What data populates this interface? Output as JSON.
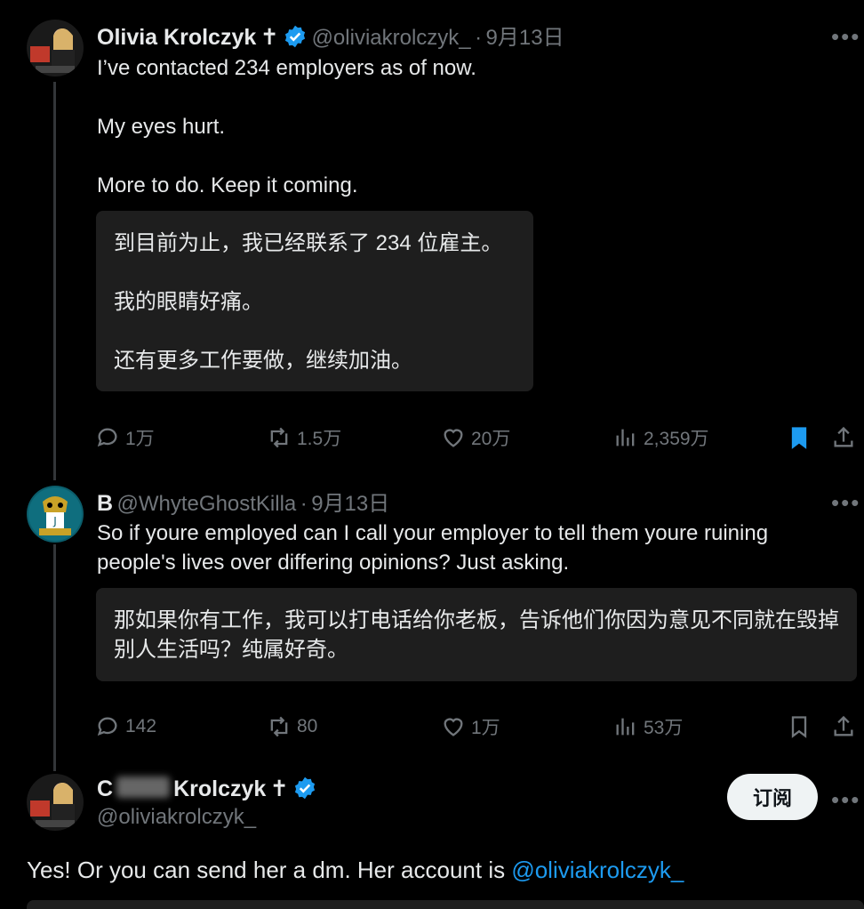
{
  "tweet1": {
    "name": "Olivia Krolczyk",
    "cross": "✝",
    "handle": "@oliviakrolczyk_",
    "dot": "·",
    "date": "9月13日",
    "text": "I’ve contacted 234 employers as of now.\n\nMy eyes hurt.\n\nMore to do. Keep it coming.",
    "translation": "到目前为止，我已经联系了 234 位雇主。\n\n我的眼睛好痛。\n\n还有更多工作要做，继续加油。",
    "replies": "1万",
    "retweets": "1.5万",
    "likes": "20万",
    "views": "2,359万",
    "bookmarked": true
  },
  "tweet2": {
    "name": "B",
    "handle": "@WhyteGhostKilla",
    "dot": "·",
    "date": "9月13日",
    "text": "So if youre employed can I call your employer to tell them youre ruining people's lives over differing opinions? Just asking.",
    "translation": "那如果你有工作，我可以打电话给你老板，告诉他们你因为意见不同就在毁掉别人生活吗？纯属好奇。",
    "replies": "142",
    "retweets": "80",
    "likes": "1万",
    "views": "53万"
  },
  "tweet3": {
    "name_initial": "C",
    "name_rest": "Krolczyk",
    "cross": "✝",
    "handle": "@oliviakrolczyk_",
    "subscribe_label": "订阅",
    "text_prefix": "Yes! Or you can send her a dm. Her account is ",
    "text_link": "@oliviakrolczyk_"
  },
  "colors": {
    "background": "#000000",
    "text": "#e7e9ea",
    "muted": "#71767b",
    "accent": "#1d9bf0",
    "translation_bg": "#1e1e1e"
  },
  "icons": [
    "reply-icon",
    "retweet-icon",
    "like-icon",
    "views-icon",
    "bookmark-icon",
    "share-icon",
    "verified-icon",
    "more-icon"
  ]
}
